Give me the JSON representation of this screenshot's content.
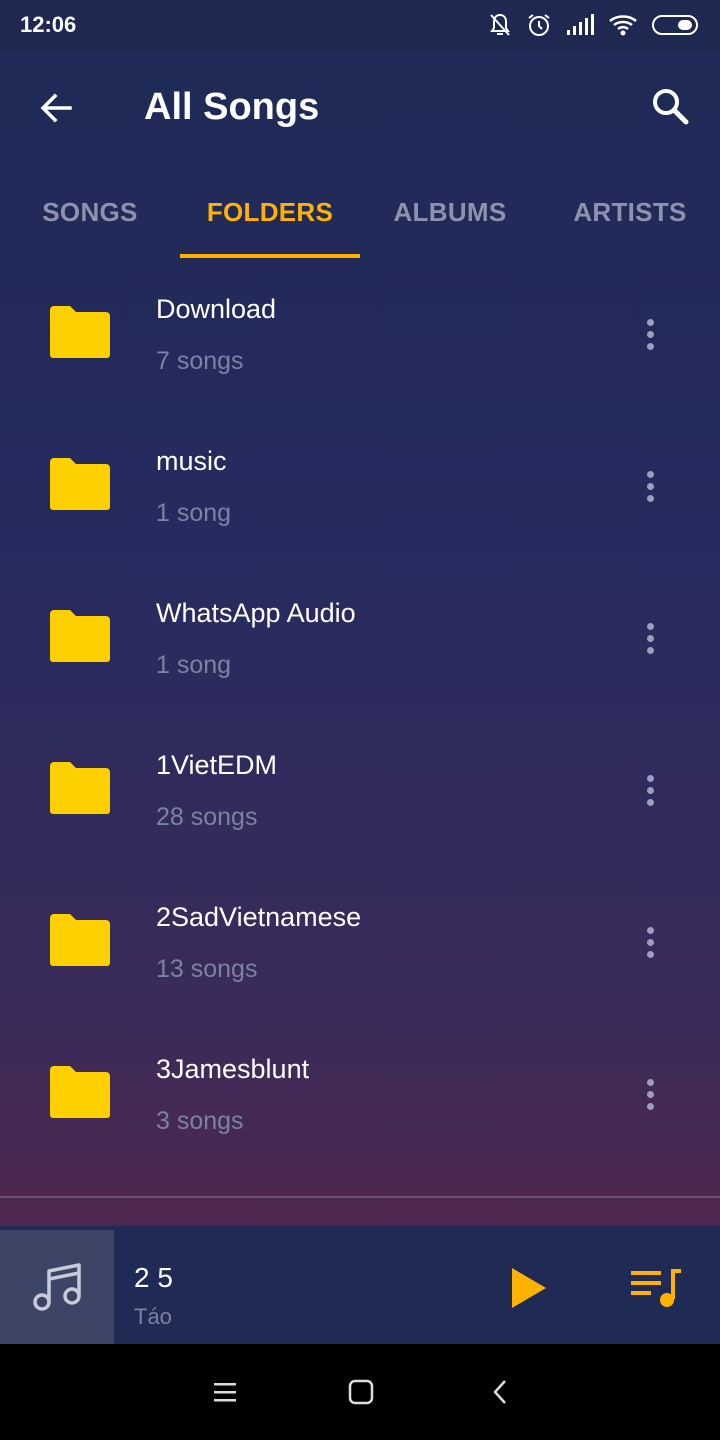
{
  "status_bar": {
    "time": "12:06",
    "icons": [
      "bell-off-icon",
      "alarm-icon",
      "signal-icon",
      "wifi-icon",
      "battery-icon"
    ]
  },
  "header": {
    "title": "All Songs",
    "back_icon": "arrow-left-icon",
    "search_icon": "search-icon"
  },
  "tabs": [
    {
      "label": "SONGS",
      "active": false
    },
    {
      "label": "FOLDERS",
      "active": true
    },
    {
      "label": "ALBUMS",
      "active": false
    },
    {
      "label": "ARTISTS",
      "active": false
    }
  ],
  "folders": [
    {
      "name": "Download",
      "count": "7 songs"
    },
    {
      "name": "music",
      "count": "1 song"
    },
    {
      "name": "WhatsApp Audio",
      "count": "1 song"
    },
    {
      "name": "1VietEDM",
      "count": "28 songs"
    },
    {
      "name": "2SadVietnamese",
      "count": "13 songs"
    },
    {
      "name": "3Jamesblunt",
      "count": "3 songs"
    }
  ],
  "player": {
    "title": "2 5",
    "artist": "Táo",
    "art_icon": "music-note-icon",
    "play_icon": "play-icon",
    "queue_icon": "queue-music-icon"
  },
  "colors": {
    "accent": "#ffb300",
    "folder": "#ffd000",
    "muted_text": "#7c82a2"
  }
}
